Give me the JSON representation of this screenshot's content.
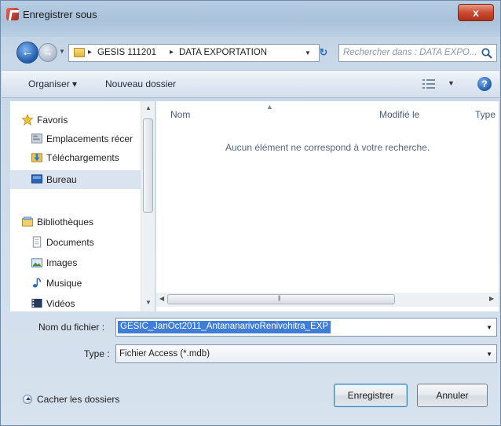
{
  "window": {
    "title": "Enregistrer sous",
    "close_label": "x"
  },
  "address": {
    "crumbs": [
      "GESIS 111201",
      "DATA EXPORTATION"
    ],
    "search_placeholder": "Rechercher dans : DATA EXPO..."
  },
  "toolbar": {
    "organize": "Organiser ▾",
    "new_folder": "Nouveau dossier",
    "help": "?"
  },
  "nav": {
    "favorites": "Favoris",
    "locations": "Emplacements récer",
    "downloads": "Téléchargements",
    "desktop": "Bureau",
    "libraries": "Bibliothèques",
    "documents": "Documents",
    "images": "Images",
    "music": "Musique",
    "videos": "Vidéos"
  },
  "columns": {
    "name": "Nom",
    "modified": "Modifié le",
    "type": "Type"
  },
  "main": {
    "empty_message": "Aucun élément ne correspond à votre recherche."
  },
  "form": {
    "filename_label": "Nom du fichier :",
    "filename_value": "GESIC_JanOct2011_AntananarivoRenivohitra_EXP",
    "type_label": "Type :",
    "type_value": "Fichier Access (*.mdb)"
  },
  "footer": {
    "hide_folders": "Cacher les dossiers",
    "save": "Enregistrer",
    "cancel": "Annuler"
  },
  "colors": {
    "accent": "#3f7dd8",
    "window_frame": "#b9cfe4",
    "close": "#c94a32"
  }
}
